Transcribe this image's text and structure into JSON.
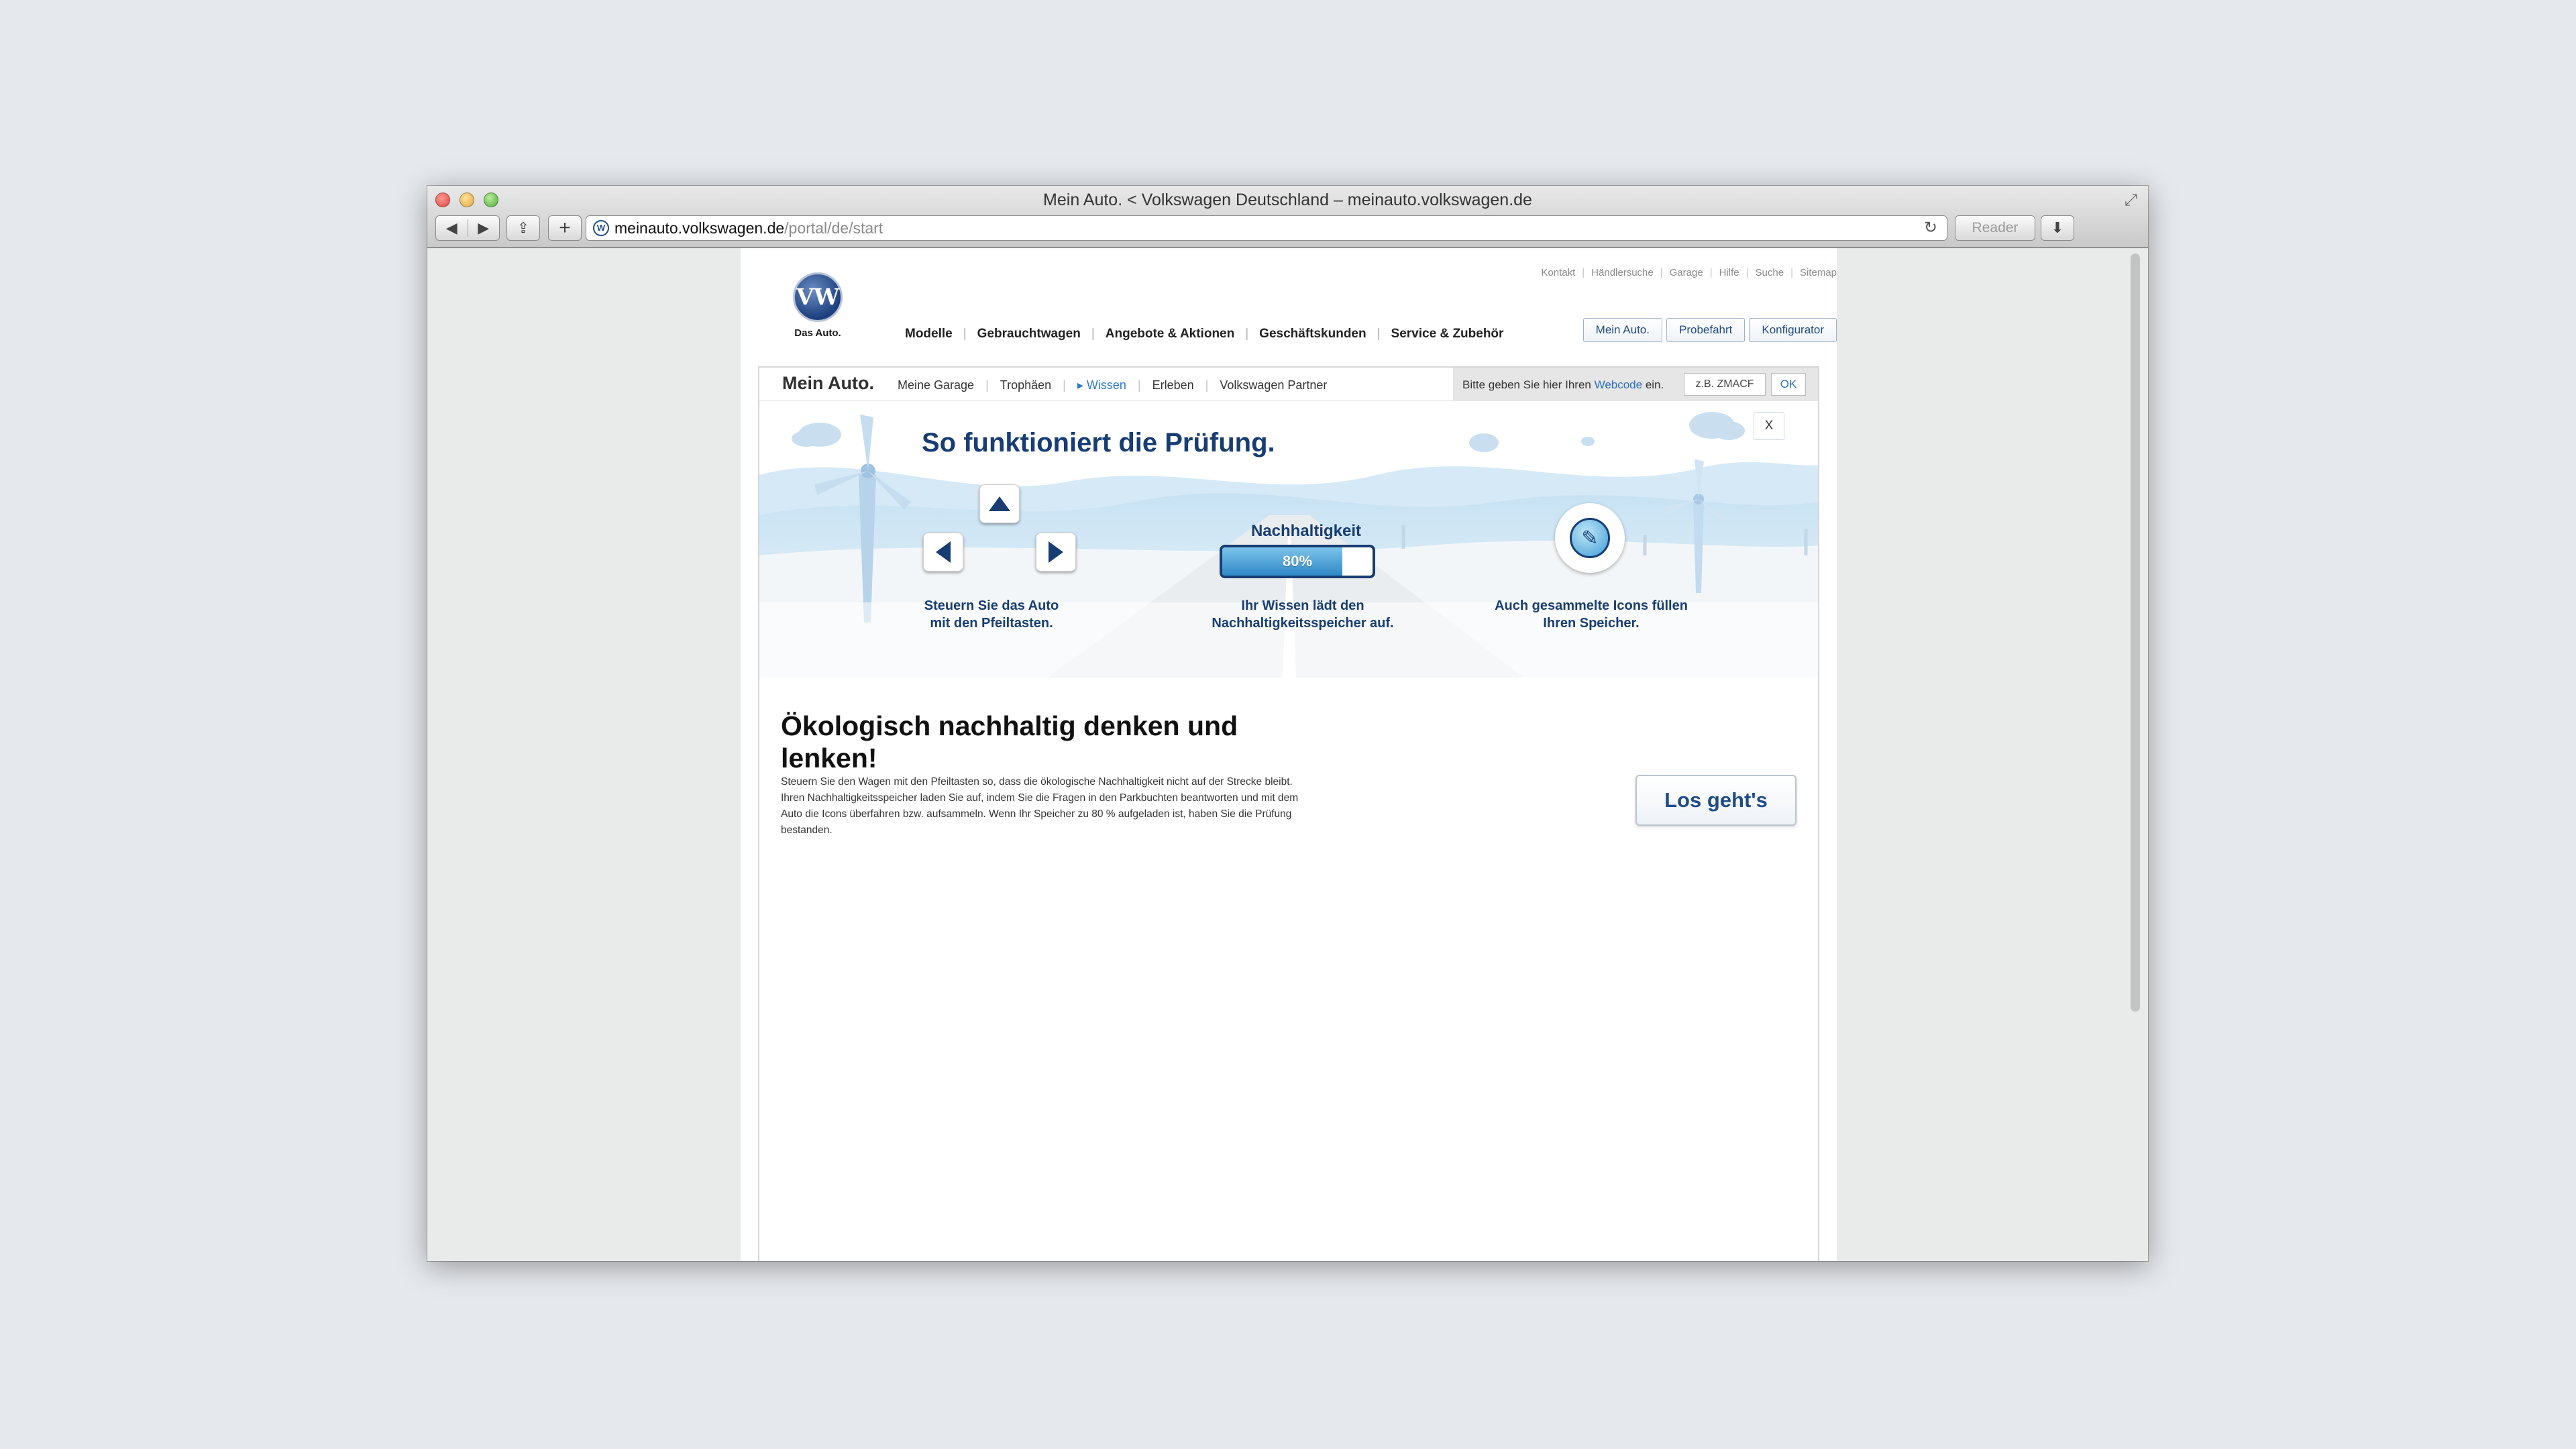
{
  "window": {
    "title": "Mein Auto. < Volkswagen Deutschland – meinauto.volkswagen.de",
    "fullscreen_icon": "⤢"
  },
  "toolbar": {
    "back_icon": "◀",
    "forward_icon": "▶",
    "share_icon": "⇪",
    "add_icon": "+",
    "url_domain": "meinauto.volkswagen.de",
    "url_path": "/portal/de/start",
    "reload_icon": "↻",
    "reader_label": "Reader",
    "download_icon": "⬇"
  },
  "header": {
    "logo_text": "VW",
    "tagline": "Das Auto.",
    "util_nav": [
      "Kontakt",
      "Händlersuche",
      "Garage",
      "Hilfe",
      "Suche",
      "Sitemap"
    ],
    "main_nav": [
      "Modelle",
      "Gebrauchtwagen",
      "Angebote & Aktionen",
      "Geschäftskunden",
      "Service & Zubehör"
    ],
    "buttons": [
      "Mein Auto.",
      "Probefahrt",
      "Konfigurator"
    ]
  },
  "subnav": {
    "title": "Mein Auto.",
    "links": [
      "Meine Garage",
      "Trophäen",
      "▸ Wissen",
      "Erleben",
      "Volkswagen Partner"
    ],
    "active_index": 2,
    "webcode_label_pre": "Bitte geben Sie hier Ihren ",
    "webcode_link": "Webcode",
    "webcode_label_post": " ein.",
    "webcode_placeholder": "z.B. ZMACF",
    "ok_label": "OK"
  },
  "illustration": {
    "title": "So funktioniert die Prüfung.",
    "close_label": "X",
    "caption_keys": [
      "Steuern Sie das Auto",
      "mit den Pfeiltasten."
    ],
    "meter_label": "Nachhaltigkeit",
    "meter_value": 80,
    "meter_text": "80%",
    "caption_meter": [
      "Ihr Wissen lädt den",
      "Nachhaltigkeitsspeicher auf."
    ],
    "caption_icons": [
      "Auch gesammelte Icons füllen",
      "Ihren Speicher."
    ],
    "gauge_icon": "✎"
  },
  "content": {
    "title": "Ökologisch nachhaltig denken und lenken!",
    "body": "Steuern Sie den Wagen mit den Pfeiltasten so, dass die ökologische Nachhaltigkeit nicht auf der Strecke bleibt. Ihren Nachhaltigkeitsspeicher laden Sie auf, indem Sie die Fragen in den Parkbuchten beantworten und mit dem Auto die Icons überfahren bzw. aufsammeln. Wenn Ihr Speicher zu 80 % aufgeladen ist, haben Sie die Prüfung bestanden.",
    "start_label": "Los geht's"
  },
  "colors": {
    "brand_blue": "#173d73",
    "link_blue": "#2a6fc1",
    "meter_fill": "#2f88c6"
  }
}
